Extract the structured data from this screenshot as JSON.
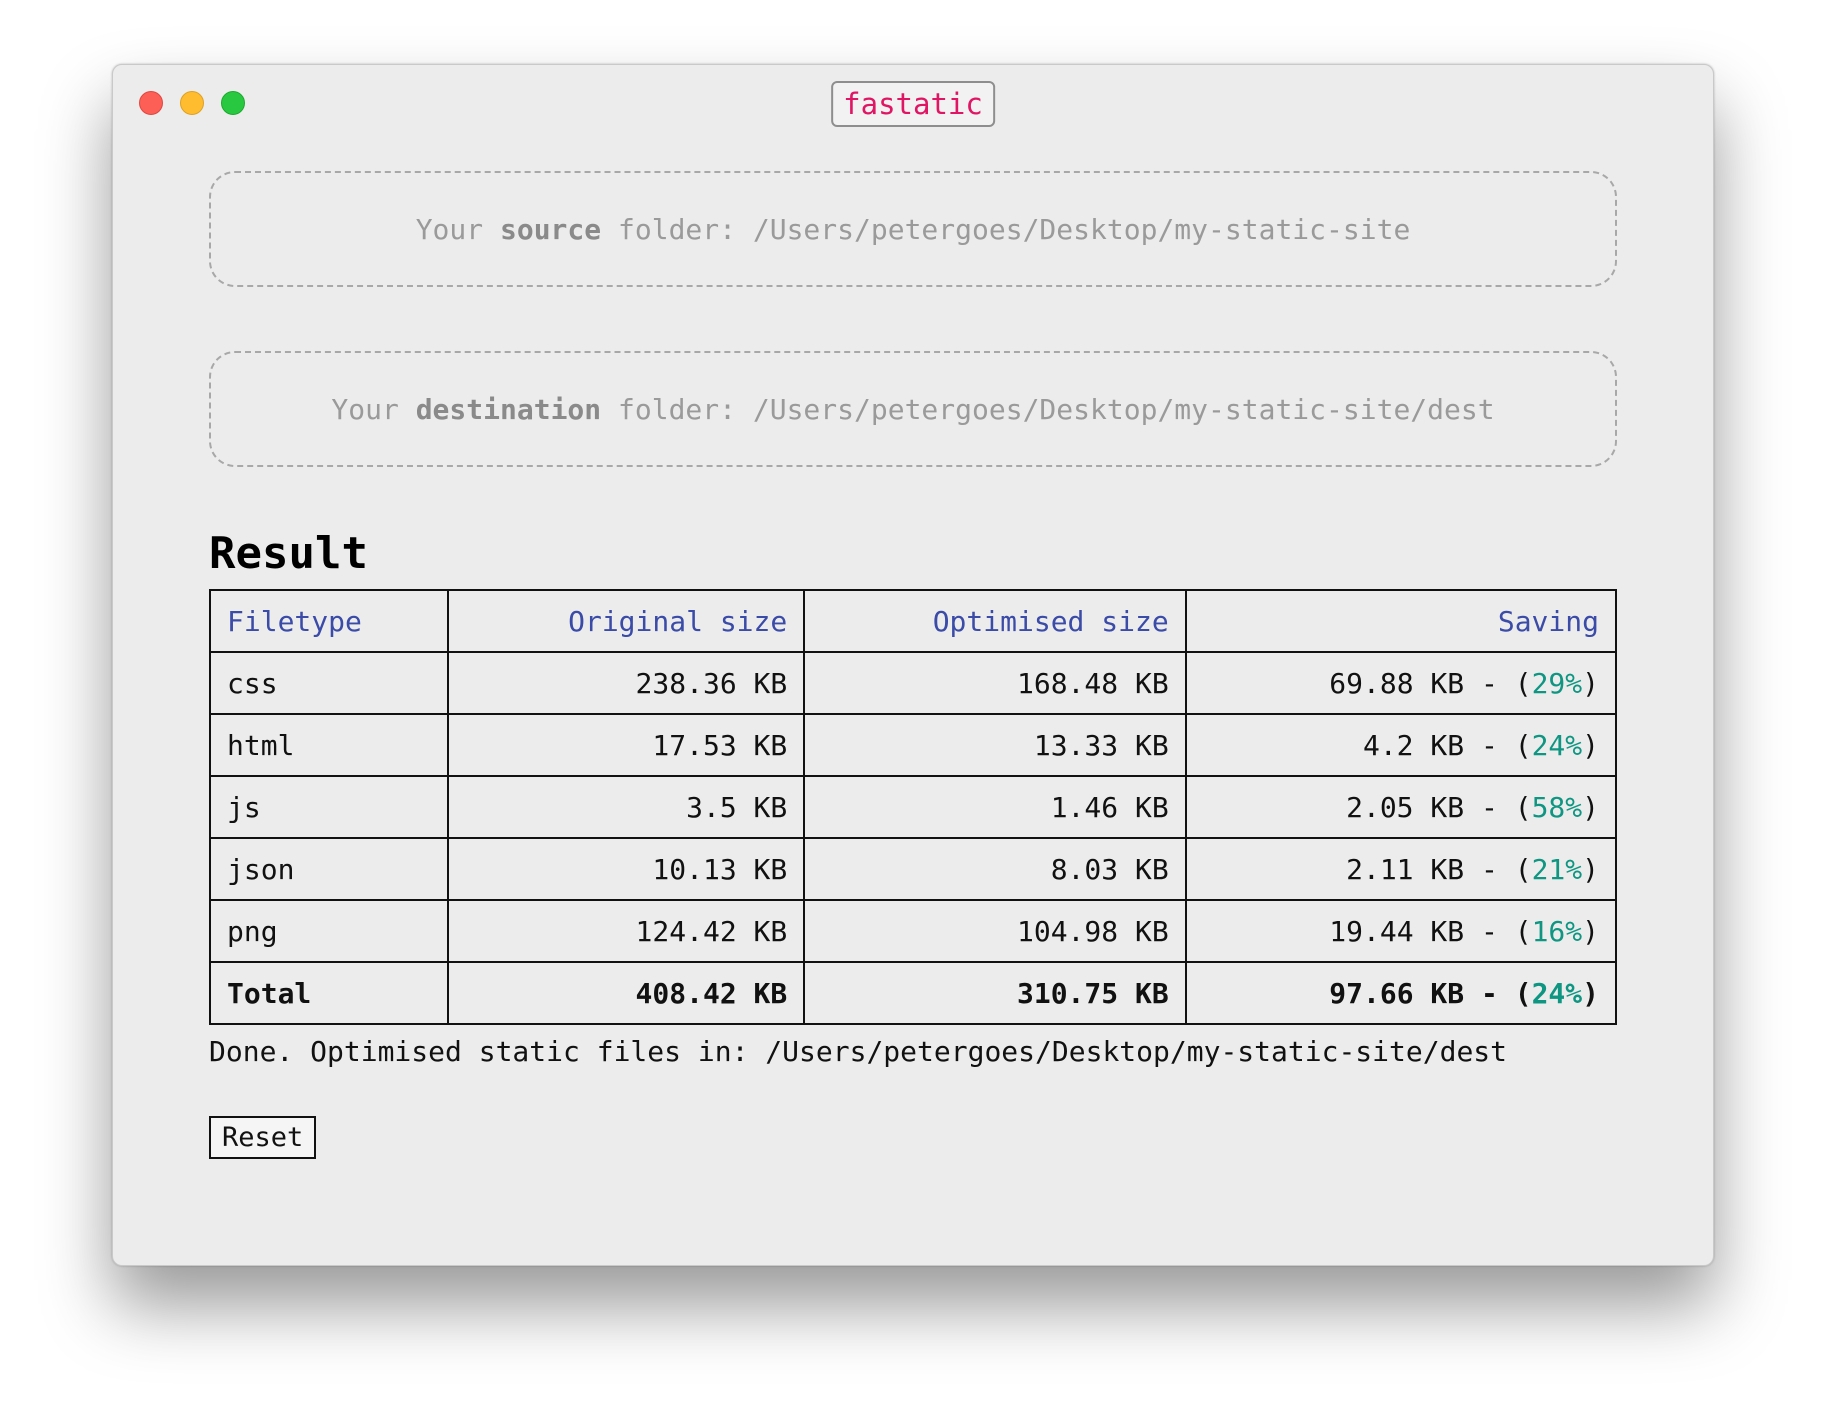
{
  "window": {
    "title": "fastatic",
    "title_color": "#e01563"
  },
  "source": {
    "prefix": "Your ",
    "keyword": "source",
    "suffix": " folder: ",
    "path": "/Users/petergoes/Desktop/my-static-site"
  },
  "destination": {
    "prefix": "Your ",
    "keyword": "destination",
    "suffix": " folder: ",
    "path": "/Users/petergoes/Desktop/my-static-site/dest"
  },
  "result": {
    "heading": "Result",
    "headers": [
      "Filetype",
      "Original size",
      "Optimised size",
      "Saving"
    ],
    "rows": [
      {
        "type": "css",
        "original": "238.36 KB",
        "optimised": "168.48 KB",
        "saving": "69.88 KB",
        "percent": "29%"
      },
      {
        "type": "html",
        "original": "17.53 KB",
        "optimised": "13.33 KB",
        "saving": "4.2 KB",
        "percent": "24%"
      },
      {
        "type": "js",
        "original": "3.5 KB",
        "optimised": "1.46 KB",
        "saving": "2.05 KB",
        "percent": "58%"
      },
      {
        "type": "json",
        "original": "10.13 KB",
        "optimised": "8.03 KB",
        "saving": "2.11 KB",
        "percent": "21%"
      },
      {
        "type": "png",
        "original": "124.42 KB",
        "optimised": "104.98 KB",
        "saving": "19.44 KB",
        "percent": "16%"
      }
    ],
    "total": {
      "type": "Total",
      "original": "408.42 KB",
      "optimised": "310.75 KB",
      "saving": "97.66 KB",
      "percent": "24%"
    },
    "saving_separator": " - (",
    "saving_close": ")"
  },
  "status": {
    "text": "Done. Optimised static files in: /Users/petergoes/Desktop/my-static-site/dest"
  },
  "actions": {
    "reset_label": "Reset"
  },
  "colors": {
    "header_text": "#3a4ba8",
    "percent_text": "#0f9682"
  }
}
